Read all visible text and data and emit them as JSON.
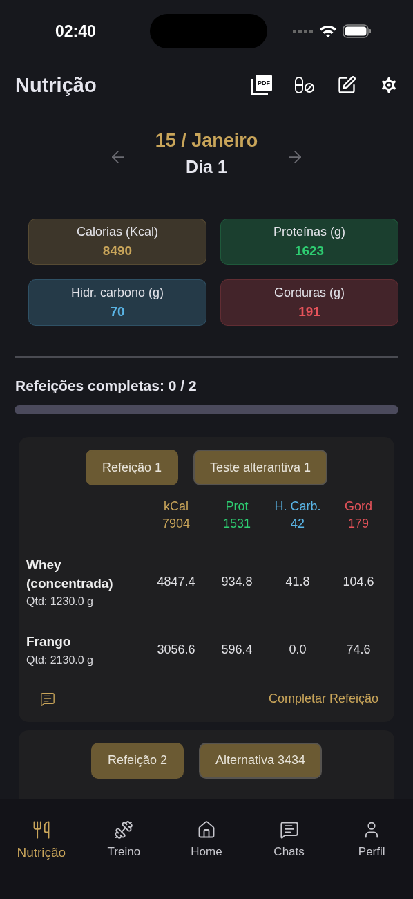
{
  "status_bar": {
    "time": "02:40"
  },
  "header": {
    "title": "Nutrição",
    "actions": [
      {
        "kind": "pdf",
        "label": "PDF"
      },
      {
        "kind": "pill-off"
      },
      {
        "kind": "edit"
      },
      {
        "kind": "settings"
      }
    ]
  },
  "date_nav": {
    "date": "15 / Janeiro",
    "day": "Dia 1"
  },
  "macros": [
    {
      "label": "Calorias (Kcal)",
      "value": "8490",
      "color": "#c9a55a"
    },
    {
      "label": "Proteínas (g)",
      "value": "1623",
      "color": "#2ecc71"
    },
    {
      "label": "Hidr. carbono (g)",
      "value": "70",
      "color": "#5ab4e5"
    },
    {
      "label": "Gorduras (g)",
      "value": "191",
      "color": "#e5535a"
    }
  ],
  "progress": {
    "label": "Refeições completas: 0 / 2",
    "level": 0
  },
  "meals": [
    {
      "options": [
        {
          "label": "Refeição 1",
          "selected": true
        },
        {
          "label": "Teste alterantiva 1",
          "selected": false
        }
      ],
      "columns": [
        {
          "label": "kCal",
          "total": "7904",
          "color": "#c9a55a"
        },
        {
          "label": "Prot",
          "total": "1531",
          "color": "#2ecc71"
        },
        {
          "label": "H. Carb.",
          "total": "42",
          "color": "#5ab4e5"
        },
        {
          "label": "Gord",
          "total": "179",
          "color": "#e5535a"
        }
      ],
      "foods": [
        {
          "name": "Whey (concentrada)",
          "quantity": "Qtd: 1230.0 g",
          "values": [
            "4847.4",
            "934.8",
            "41.8",
            "104.6"
          ]
        },
        {
          "name": "Frango",
          "quantity": "Qtd: 2130.0 g",
          "values": [
            "3056.6",
            "596.4",
            "0.0",
            "74.6"
          ]
        }
      ],
      "complete_button": "Completar Refeição"
    },
    {
      "options": [
        {
          "label": "Refeição 2",
          "selected": true
        },
        {
          "label": "Alternativa 3434",
          "selected": false
        }
      ]
    }
  ],
  "tab_bar": [
    {
      "label": "Nutrição",
      "selected": true
    },
    {
      "label": "Treino",
      "selected": false
    },
    {
      "label": "Home",
      "selected": false
    },
    {
      "label": "Chats",
      "selected": false
    },
    {
      "label": "Perfil",
      "selected": false
    }
  ]
}
